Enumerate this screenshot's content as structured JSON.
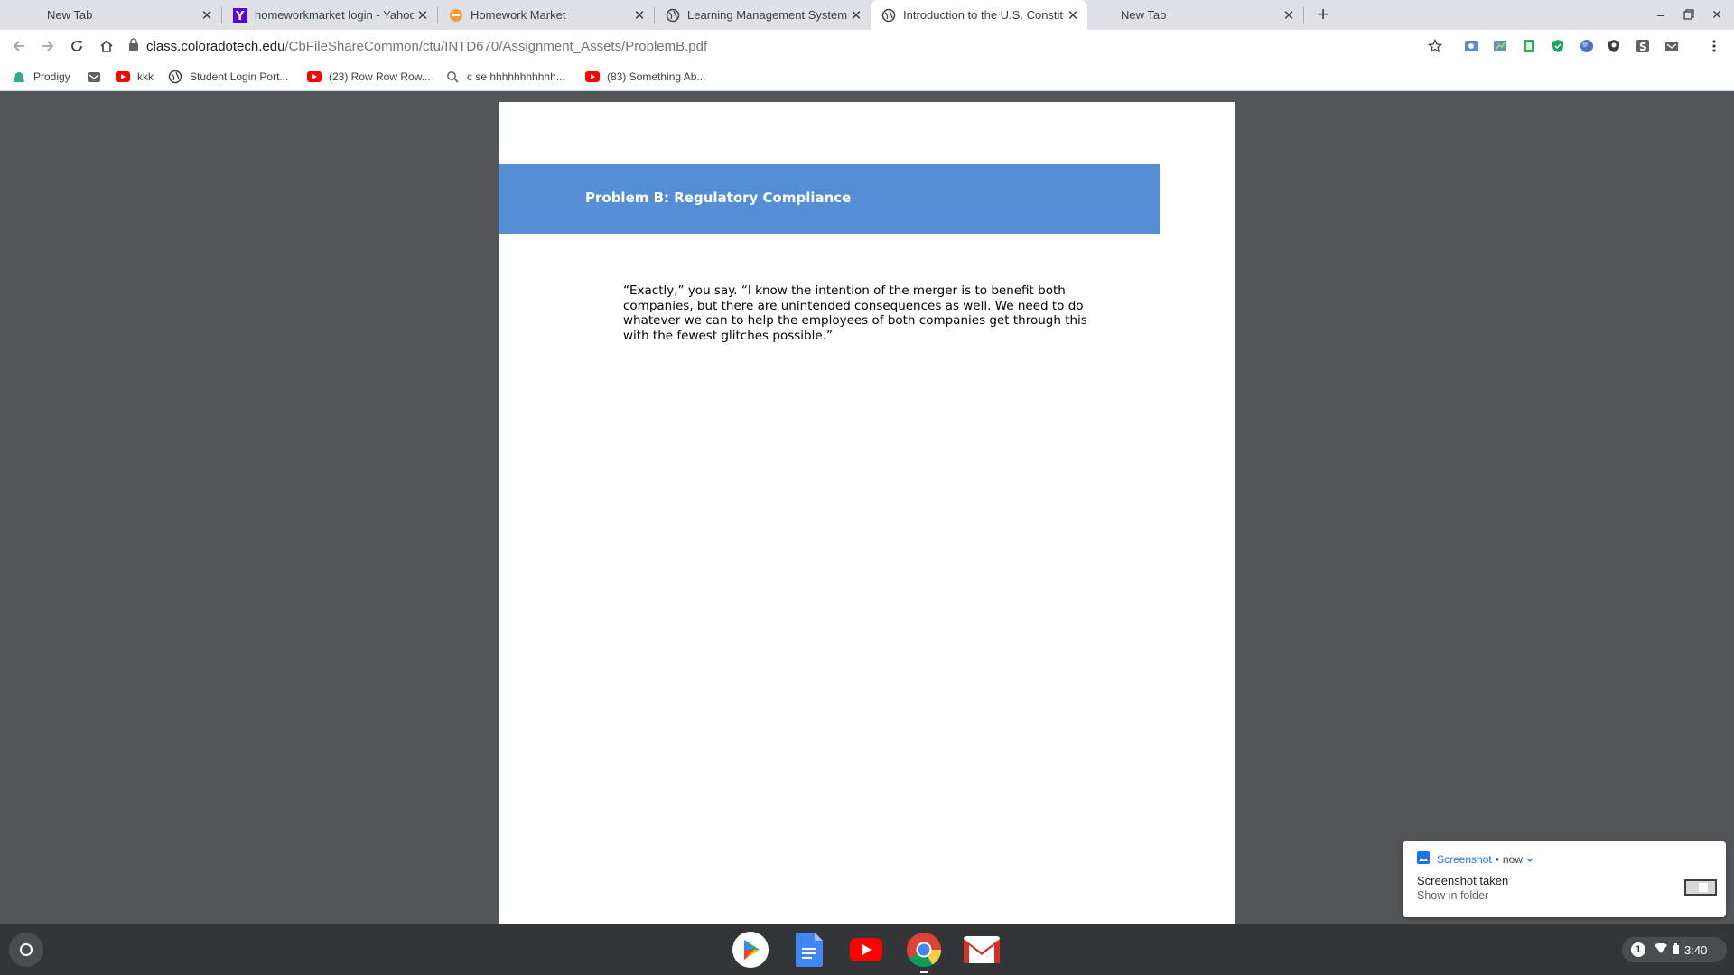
{
  "tabs": [
    {
      "title": "New Tab",
      "icon": "none"
    },
    {
      "title": "homeworkmarket login - Yahoo Search Results",
      "icon": "yahoo-icon"
    },
    {
      "title": "Homework Market",
      "icon": "homework-market-icon"
    },
    {
      "title": "Learning Management System",
      "icon": "globe-icon"
    },
    {
      "title": "Introduction to the U.S. Constitution",
      "icon": "globe-icon"
    },
    {
      "title": "New Tab",
      "icon": "none"
    }
  ],
  "active_tab_index": 4,
  "new_tab_label": "+",
  "address_bar": {
    "domain": "class.coloradotech.edu",
    "path": "/CbFileShareCommon/ctu/INTD670/Assignment_Assets/ProblemB.pdf"
  },
  "bookmarks": [
    {
      "label": "Prodigy",
      "icon": "prodigy-icon"
    },
    {
      "label": "",
      "icon": "mail-icon"
    },
    {
      "label": "kkk",
      "icon": "youtube-icon"
    },
    {
      "label": "Student Login Port...",
      "icon": "globe-icon"
    },
    {
      "label": "(23) Row Row Row...",
      "icon": "youtube-icon"
    },
    {
      "label": "c se hhhhhhhhhhh...",
      "icon": "search-icon"
    },
    {
      "label": "(83) Something Ab...",
      "icon": "youtube-icon"
    }
  ],
  "document": {
    "banner_title": "Problem B: Regulatory Compliance",
    "paragraph": "“Exactly,” you say. “I know the intention of the merger is to benefit both companies, but there are unintended consequences as well. We need to do whatever we can to help the employees of both companies get through this with the fewest glitches possible.”",
    "banner_color": "#558ed5"
  },
  "notification": {
    "app": "Screenshot",
    "time": "now",
    "title": "Screenshot taken",
    "action": "Show in folder"
  },
  "shelf": {
    "apps": [
      "play-store-icon",
      "google-docs-icon",
      "youtube-icon",
      "chrome-icon",
      "gmail-icon"
    ],
    "status": {
      "notification_count": "1",
      "time": "3:40"
    }
  }
}
